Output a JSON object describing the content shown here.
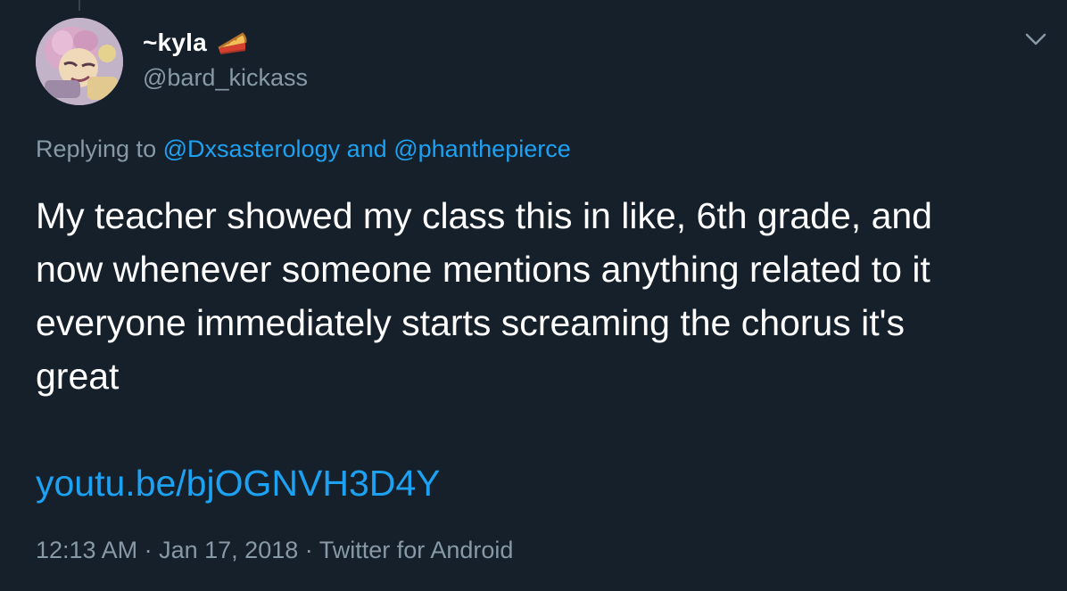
{
  "tweet": {
    "display_name": "~kyla",
    "display_name_emoji": "pie-icon",
    "handle": "@bard_kickass",
    "replying_prefix": "Replying to",
    "reply_to_1": "@Dxsasterology",
    "reply_joiner": "and",
    "reply_to_2": "@phanthepierce",
    "text": "My teacher showed my class this in like, 6th grade, and\nnow whenever someone mentions anything related to it\neveryone immediately starts screaming the chorus it's\ngreat",
    "link": "youtu.be/bjOGNVH3D4Y",
    "time": "12:13 AM",
    "separator": "·",
    "date": "Jan 17, 2018",
    "source": "Twitter for Android"
  },
  "colors": {
    "background": "#15202b",
    "text_primary": "#ffffff",
    "text_secondary": "#8899a6",
    "link": "#1da1f2"
  },
  "icons": {
    "menu": "chevron-down-icon",
    "avatar": "avatar"
  }
}
